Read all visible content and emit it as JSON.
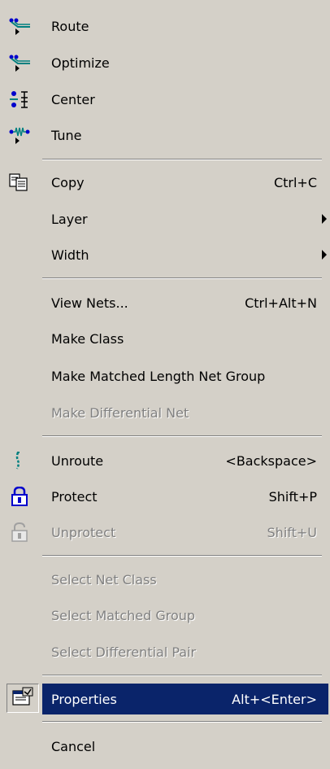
{
  "menu": {
    "route": {
      "label": "Route",
      "icon": "route-icon"
    },
    "optimize": {
      "label": "Optimize",
      "icon": "optimize-icon"
    },
    "center": {
      "label": "Center",
      "icon": "center-icon"
    },
    "tune": {
      "label": "Tune",
      "icon": "tune-icon"
    },
    "copy": {
      "label": "Copy",
      "shortcut": "Ctrl+C",
      "icon": "copy-icon"
    },
    "layer": {
      "label": "Layer"
    },
    "width": {
      "label": "Width"
    },
    "view_nets": {
      "label": "View Nets...",
      "shortcut": "Ctrl+Alt+N"
    },
    "make_class": {
      "label": "Make Class"
    },
    "make_matched": {
      "label": "Make Matched Length Net Group"
    },
    "make_diff": {
      "label": "Make Differential Net",
      "disabled": true
    },
    "unroute": {
      "label": "Unroute",
      "shortcut": "<Backspace>",
      "icon": "unroute-icon"
    },
    "protect": {
      "label": "Protect",
      "shortcut": "Shift+P",
      "icon": "lock-icon"
    },
    "unprotect": {
      "label": "Unprotect",
      "shortcut": "Shift+U",
      "icon": "unlock-icon",
      "disabled": true
    },
    "select_net_class": {
      "label": "Select Net Class",
      "disabled": true
    },
    "select_matched": {
      "label": "Select Matched Group",
      "disabled": true
    },
    "select_diff_pair": {
      "label": "Select Differential Pair",
      "disabled": true
    },
    "properties": {
      "label": "Properties",
      "shortcut": "Alt+<Enter>",
      "icon": "properties-icon",
      "selected": true
    },
    "cancel": {
      "label": "Cancel"
    }
  },
  "colors": {
    "menu_bg": "#d4d0c8",
    "highlight": "#0a246a",
    "disabled_text": "#808080",
    "icon_teal": "#008080",
    "icon_blue": "#0000cc"
  }
}
